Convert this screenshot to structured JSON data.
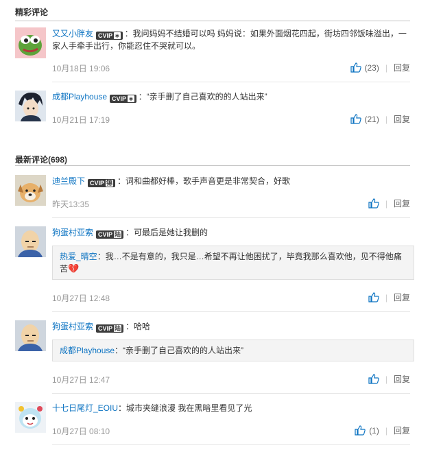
{
  "sections": {
    "hot_title": "精彩评论",
    "new_title": "最新评论(698)"
  },
  "vip": {
    "prefix": "CVIP",
    "level1": "∗",
    "level2": "锦",
    "level3": "陆"
  },
  "comments": [
    {
      "user": "又又小胖友",
      "text": "：我问妈妈不结婚可以吗 妈妈说：如果外面烟花四起，街坊四邻饭味溢出，一家人手牵手出行，你能忍住不哭就可以。",
      "time": "10月18日 19:06",
      "likes": "(23)",
      "reply": "回复"
    },
    {
      "user": "成都Playhouse",
      "text": "：“亲手删了自己喜欢的的人站出来”",
      "time": "10月21日 17:19",
      "likes": "(21)",
      "reply": "回复"
    },
    {
      "user": "迪兰殿下",
      "text": "：词和曲都好棒，歌手声音更是非常契合，好歌",
      "time": "昨天13:35",
      "reply": "回复"
    },
    {
      "user": "狗蛋村亚索",
      "text": "：可最后是她让我删的",
      "quoted_user": "热爱_晴空",
      "quoted_text": "：我…不是有意的，我只是…希望不再让他困扰了，毕竟我那么喜欢他，见不得他痛苦",
      "quoted_emoji": "💔",
      "time": "10月27日 12:48",
      "reply": "回复"
    },
    {
      "user": "狗蛋村亚索",
      "text": "：哈哈",
      "quoted_user": "成都Playhouse",
      "quoted_text": "：“亲手删了自己喜欢的的人站出来”",
      "time": "10月27日 12:47",
      "reply": "回复"
    },
    {
      "user": "十七日尾灯_EOIU",
      "text": "：城市夹缝浪漫 我在黑暗里看见了光",
      "time": "10月27日 08:10",
      "likes": "(1)",
      "reply": "回复"
    }
  ],
  "icons": {
    "like": "thumbs-up-icon",
    "broken_heart": "broken-heart-emoji"
  },
  "colors": {
    "username": "#0c73c2",
    "time": "#999999",
    "reply_bg": "#f4f4f4"
  }
}
